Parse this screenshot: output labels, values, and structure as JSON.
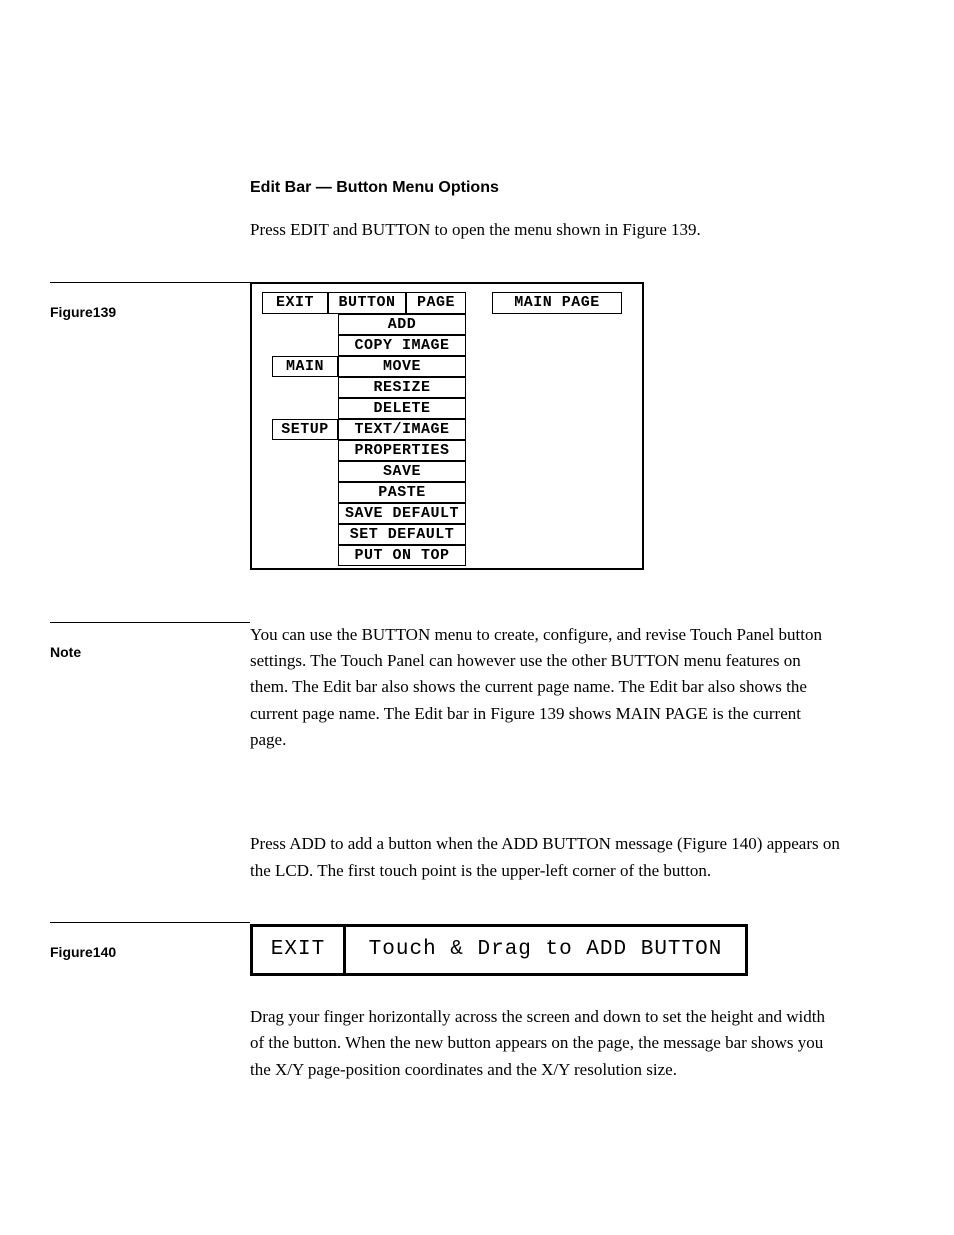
{
  "section_title": "Edit Bar — Button Menu Options",
  "intro_text": "Press EDIT and BUTTON to open the menu shown in Figure 139.",
  "figure1": {
    "caption": "Figure139",
    "topbar": {
      "exit": "EXIT",
      "button": "BUTTON",
      "page": "PAGE",
      "main_page": "MAIN PAGE"
    },
    "side": {
      "main": "MAIN",
      "setup": "SETUP"
    },
    "menu": [
      "ADD",
      "COPY IMAGE",
      "MOVE",
      "RESIZE",
      "DELETE",
      "TEXT/IMAGE",
      "PROPERTIES",
      "SAVE",
      "PASTE",
      "SAVE DEFAULT",
      "SET DEFAULT",
      "PUT ON TOP"
    ]
  },
  "note_label": "Note",
  "note_text": "You can use the BUTTON menu to create, configure, and revise Touch Panel button settings. The Touch Panel can however use the other BUTTON menu features on them. The Edit bar also shows the current page name. The Edit bar also shows the current page name. The Edit bar in Figure 139 shows MAIN PAGE is the current page.",
  "add_intro": "Press ADD to add a button when the ADD BUTTON message (Figure 140) appears on the LCD. The first touch point is the upper-left corner of the button.",
  "figure2": {
    "caption": "Figure140",
    "exit": "EXIT",
    "message": "Touch & Drag to ADD BUTTON"
  },
  "drag_text": "Drag your finger horizontally across the screen and down to set the height and width of the button. When the new button appears on the page, the message bar shows you the X/Y page-position coordinates and the X/Y resolution size."
}
